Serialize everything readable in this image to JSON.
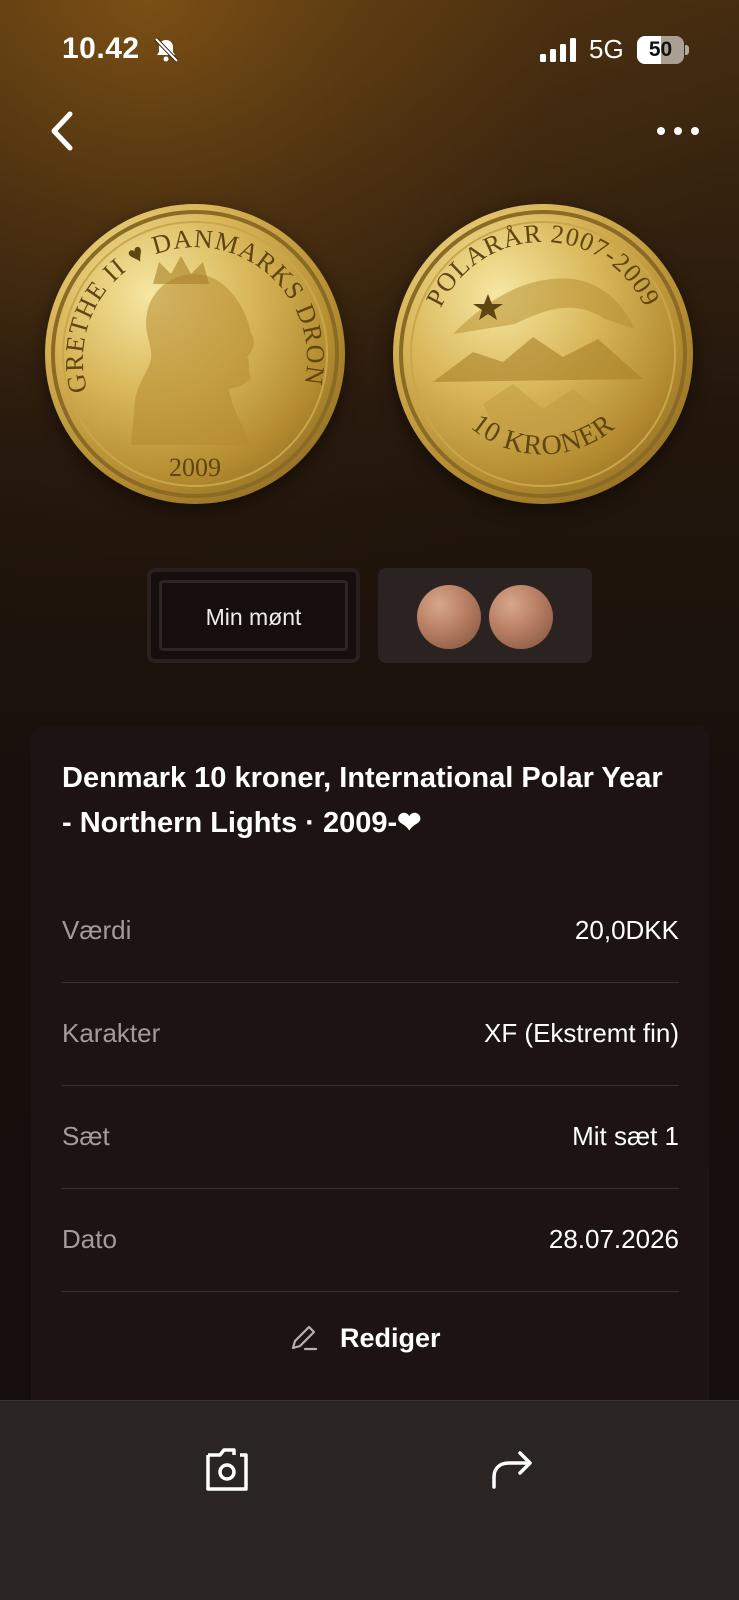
{
  "status_bar": {
    "time": "10.42",
    "network": "5G",
    "battery": "50",
    "battery_level": 0.5
  },
  "nav": {
    "back_icon": "chevron-left-icon",
    "more_icon": "ellipsis-icon"
  },
  "coin_images": {
    "obverse": {
      "inscription": "MARGRETHE II ♥ DANMARKS DRONNING",
      "year": "2009"
    },
    "reverse": {
      "inscription": "POLARÅR 2007-2009",
      "denomination": "10 KRONER"
    }
  },
  "image_tabs": {
    "my_coin_label": "Min mønt"
  },
  "coin": {
    "title": "Denmark 10 kroner, International Polar Year - Northern Lights · 2009-❤"
  },
  "details": [
    {
      "label": "Værdi",
      "value": "20,0DKK"
    },
    {
      "label": "Karakter",
      "value": "XF (Ekstremt fin)"
    },
    {
      "label": "Sæt",
      "value": "Mit sæt 1"
    },
    {
      "label": "Dato",
      "value": "28.07.2026"
    }
  ],
  "edit": {
    "label": "Rediger",
    "icon": "pencil-icon"
  },
  "bottom_bar": {
    "photo_icon": "camera-frame-icon",
    "share_icon": "share-arrow-icon"
  },
  "colors": {
    "accent_gold": "#d9b75a",
    "card_bg": "#1c1312",
    "label_gray": "#a49b98"
  }
}
